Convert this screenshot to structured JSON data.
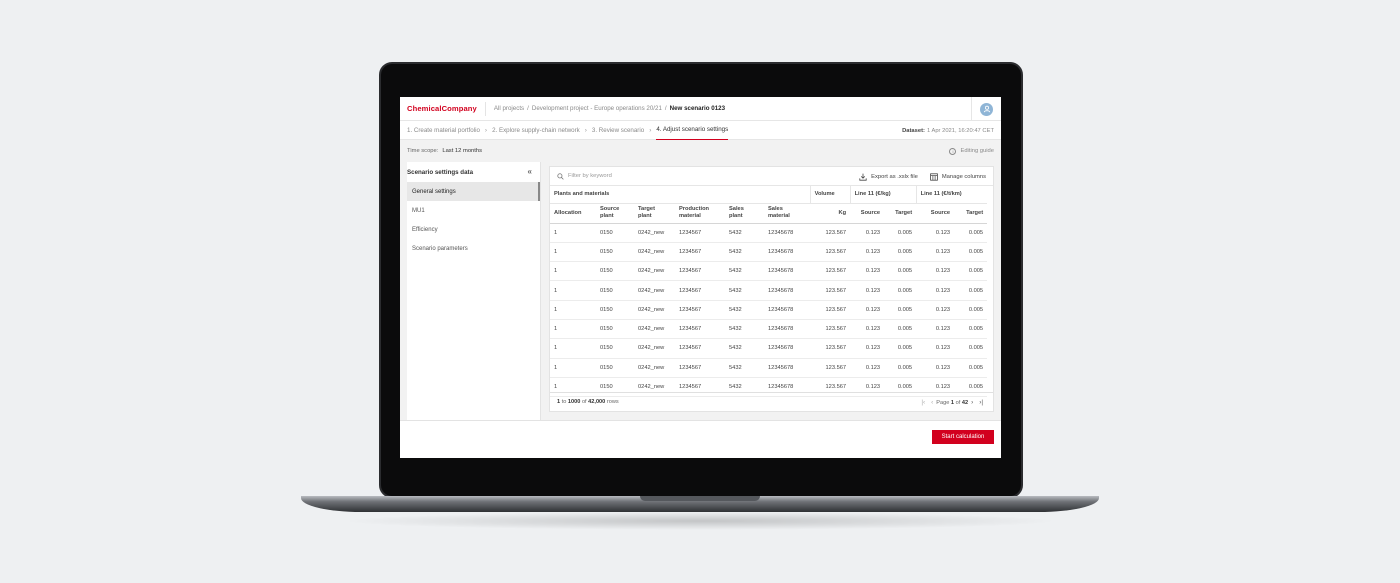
{
  "brand": "ChemicalCompany",
  "breadcrumb": {
    "items": [
      "All projects",
      "Development project - Europe operations 20/21"
    ],
    "separator": "/",
    "current": "New scenario 0123"
  },
  "steps": [
    {
      "label": "1. Create material portfolio",
      "active": false
    },
    {
      "label": "2. Explore supply-chain network",
      "active": false
    },
    {
      "label": "3. Review scenario",
      "active": false
    },
    {
      "label": "4. Adjust scenario settings",
      "active": true
    }
  ],
  "dataset": {
    "label": "Dataset:",
    "value": "1 Apr 2021, 16:20:47 CET"
  },
  "time_scope": {
    "label": "Time scope:",
    "value": "Last 12 months"
  },
  "editing_guide": "Editing guide",
  "sidebar": {
    "title": "Scenario settings data",
    "items": [
      {
        "label": "General settings",
        "active": true
      },
      {
        "label": "MU1",
        "active": false
      },
      {
        "label": "Efficiency",
        "active": false
      },
      {
        "label": "Scenario parameters",
        "active": false
      }
    ]
  },
  "table": {
    "filter_placeholder": "Filter by keyword",
    "export_label": "Export as .xslx file",
    "manage_label": "Manage columns",
    "groups": {
      "plants": "Plants and materials",
      "volume": "Volume",
      "line_kg": "Line 11 (€/kg)",
      "line_tkm": "Line 11 (€/t/km)"
    },
    "columns": [
      {
        "line1": "Allocation",
        "line2": "",
        "numeric": false
      },
      {
        "line1": "Source",
        "line2": "plant",
        "numeric": false
      },
      {
        "line1": "Target",
        "line2": "plant",
        "numeric": false
      },
      {
        "line1": "Production",
        "line2": "material",
        "numeric": false
      },
      {
        "line1": "Sales",
        "line2": "plant",
        "numeric": false
      },
      {
        "line1": "Sales",
        "line2": "material",
        "numeric": false
      },
      {
        "line1": "Kg",
        "line2": "",
        "numeric": true
      },
      {
        "line1": "Source",
        "line2": "",
        "numeric": true
      },
      {
        "line1": "Target",
        "line2": "",
        "numeric": true
      },
      {
        "line1": "Source",
        "line2": "",
        "numeric": true
      },
      {
        "line1": "Target",
        "line2": "",
        "numeric": true
      }
    ],
    "rows": [
      [
        "1",
        "0150",
        "0242_new",
        "1234567",
        "5432",
        "12345678",
        "123.567",
        "0.123",
        "0.005",
        "0.123",
        "0.005"
      ],
      [
        "1",
        "0150",
        "0242_new",
        "1234567",
        "5432",
        "12345678",
        "123.567",
        "0.123",
        "0.005",
        "0.123",
        "0.005"
      ],
      [
        "1",
        "0150",
        "0242_new",
        "1234567",
        "5432",
        "12345678",
        "123.567",
        "0.123",
        "0.005",
        "0.123",
        "0.005"
      ],
      [
        "1",
        "0150",
        "0242_new",
        "1234567",
        "5432",
        "12345678",
        "123.567",
        "0.123",
        "0.005",
        "0.123",
        "0.005"
      ],
      [
        "1",
        "0150",
        "0242_new",
        "1234567",
        "5432",
        "12345678",
        "123.567",
        "0.123",
        "0.005",
        "0.123",
        "0.005"
      ],
      [
        "1",
        "0150",
        "0242_new",
        "1234567",
        "5432",
        "12345678",
        "123.567",
        "0.123",
        "0.005",
        "0.123",
        "0.005"
      ],
      [
        "1",
        "0150",
        "0242_new",
        "1234567",
        "5432",
        "12345678",
        "123.567",
        "0.123",
        "0.005",
        "0.123",
        "0.005"
      ],
      [
        "1",
        "0150",
        "0242_new",
        "1234567",
        "5432",
        "12345678",
        "123.567",
        "0.123",
        "0.005",
        "0.123",
        "0.005"
      ],
      [
        "1",
        "0150",
        "0242_new",
        "1234567",
        "5432",
        "12345678",
        "123.567",
        "0.123",
        "0.005",
        "0.123",
        "0.005"
      ]
    ],
    "footer": {
      "range_start": "1",
      "range_to": "to",
      "range_end": "1000",
      "of": "of",
      "total": "42,000",
      "rows_label": "rows"
    },
    "pagination": {
      "page_label": "Page",
      "current": "1",
      "of": "of",
      "total": "42"
    }
  },
  "start_button": "Start calculation",
  "colors": {
    "accent": "#d2001e",
    "avatar": "#8fb5d6"
  }
}
